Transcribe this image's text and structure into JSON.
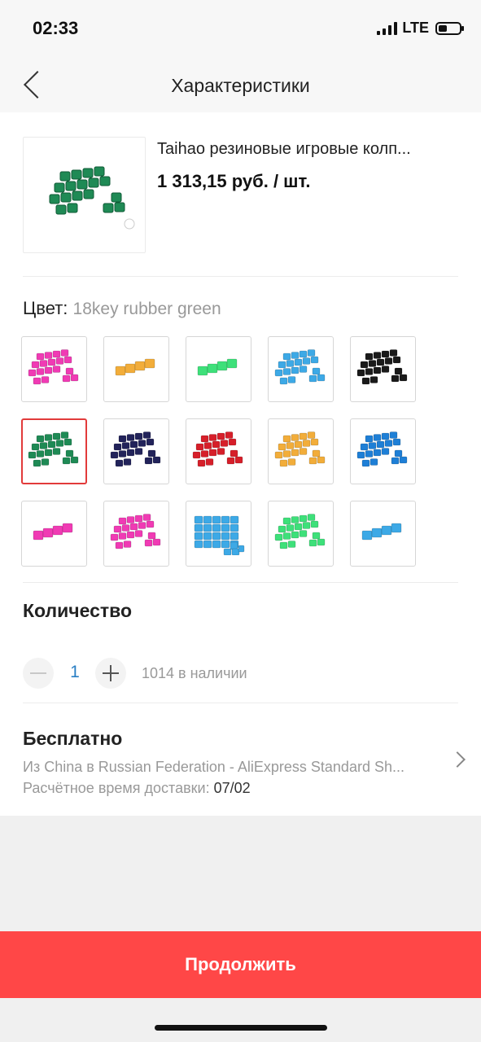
{
  "status_bar": {
    "time": "02:33",
    "network": "LTE"
  },
  "nav": {
    "title": "Характеристики",
    "back_icon": "chevron-left-icon"
  },
  "product": {
    "title": "Taihao резиновые игровые колп...",
    "price": "1 313,15 руб. / шт.",
    "image_color": "#1f8a55"
  },
  "color": {
    "label": "Цвет:",
    "selected_value": "18key rubber green",
    "selected_index": 5,
    "swatches": [
      {
        "color": "#f03bb4",
        "keys": 18
      },
      {
        "color": "#f2ad3a",
        "keys": 4
      },
      {
        "color": "#3ee07a",
        "keys": 4
      },
      {
        "color": "#3da9e6",
        "keys": 18
      },
      {
        "color": "#1a1a1a",
        "keys": 18
      },
      {
        "color": "#1f8a55",
        "keys": 18
      },
      {
        "color": "#22235a",
        "keys": 18
      },
      {
        "color": "#d61f2a",
        "keys": 18
      },
      {
        "color": "#f2ad3a",
        "keys": 18
      },
      {
        "color": "#1e7fd6",
        "keys": 18
      },
      {
        "color": "#f03bb4",
        "keys": 4
      },
      {
        "color": "#f03bb4",
        "keys": 18
      },
      {
        "color": "#3da9e6",
        "keys": 24
      },
      {
        "color": "#3ee07a",
        "keys": 18
      },
      {
        "color": "#3da9e6",
        "keys": 4
      }
    ]
  },
  "quantity": {
    "label": "Количество",
    "value": "1",
    "stock": "1014 в наличии"
  },
  "shipping": {
    "title": "Бесплатно",
    "route": "Из China в Russian Federation - AliExpress Standard Sh...",
    "eta_label": "Расчётное время доставки:",
    "eta_date": "07/02"
  },
  "footer": {
    "continue_label": "Продолжить"
  }
}
